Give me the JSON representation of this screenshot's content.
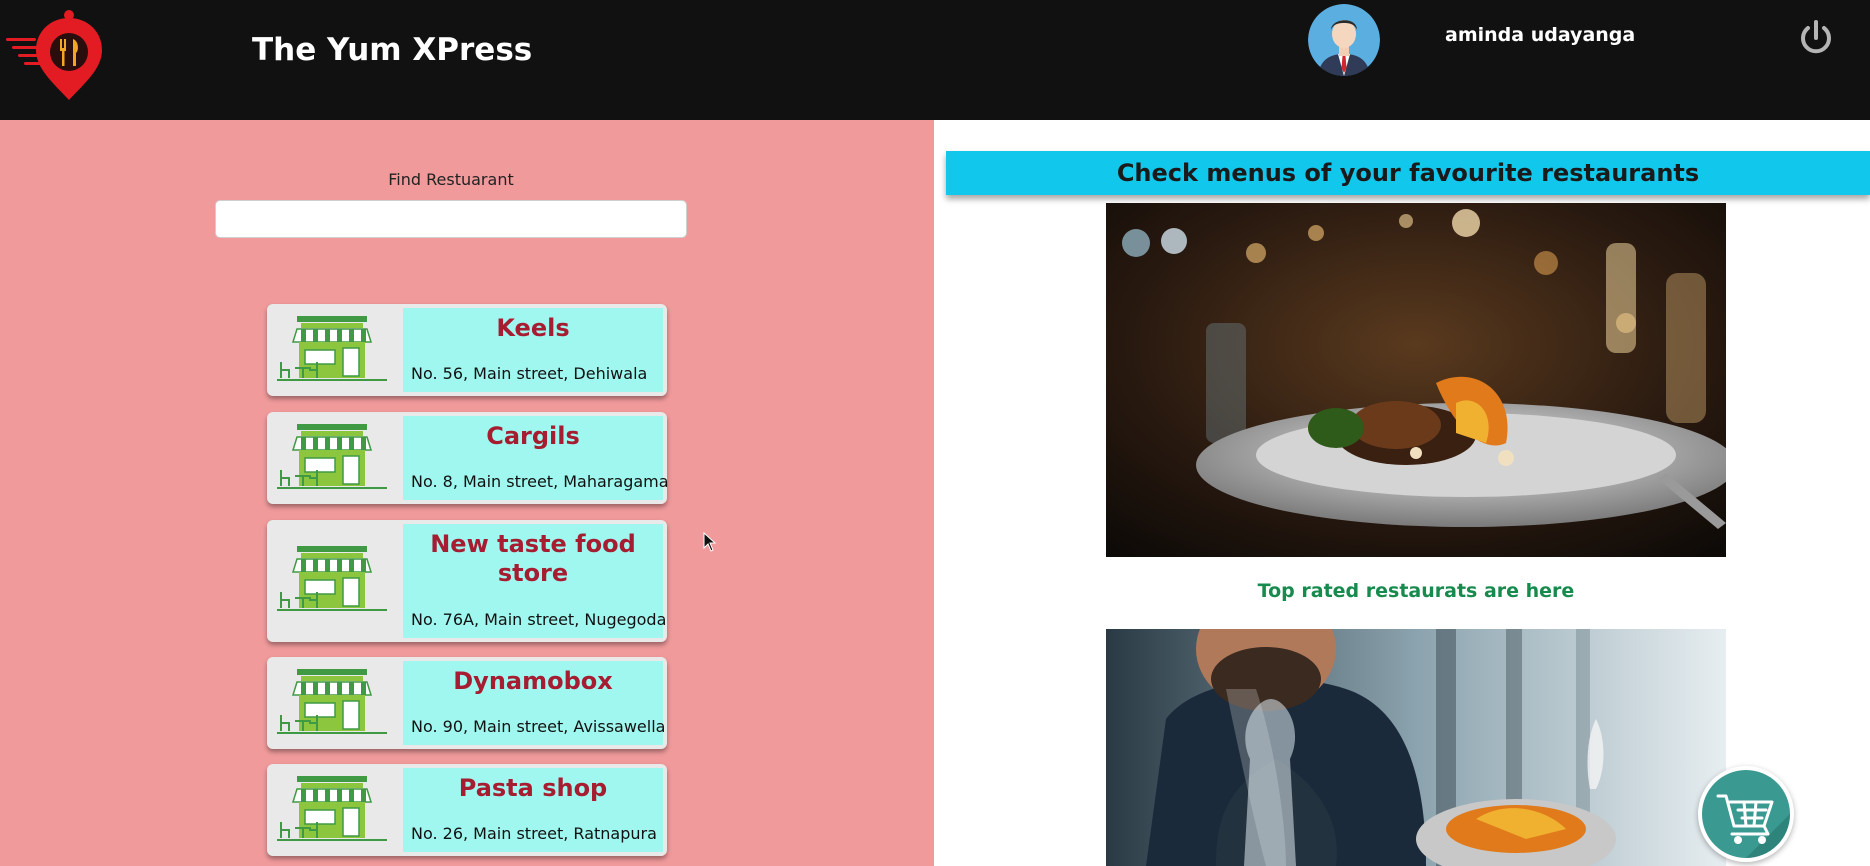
{
  "header": {
    "app_title": "The Yum XPress",
    "user_name": "aminda udayanga",
    "logo_icon": "food-location-pin-logo",
    "power_icon": "power-icon"
  },
  "search": {
    "label": "Find Restuarant",
    "value": "",
    "placeholder": ""
  },
  "restaurants": [
    {
      "name": "Keels",
      "address": "No. 56, Main street, Dehiwala"
    },
    {
      "name": "Cargils",
      "address": "No. 8, Main street, Maharagama"
    },
    {
      "name": "New taste food store",
      "address": "No. 76A, Main street, Nugegoda"
    },
    {
      "name": "Dynamobox",
      "address": "No. 90, Main street, Avissawella"
    },
    {
      "name": "Pasta shop",
      "address": "No. 26, Main street, Ratnapura"
    }
  ],
  "right_panel": {
    "banner": "Check menus of your favourite restaurants",
    "caption": "Top rated restaurats are here"
  },
  "colors": {
    "header_bg": "#111111",
    "left_panel_bg": "#f09a9b",
    "card_info_bg": "#9ff7ef",
    "store_name": "#a61c30",
    "banner_bg": "#12c7ec",
    "caption": "#178a4d",
    "cart_bg": "#3a9a92"
  }
}
